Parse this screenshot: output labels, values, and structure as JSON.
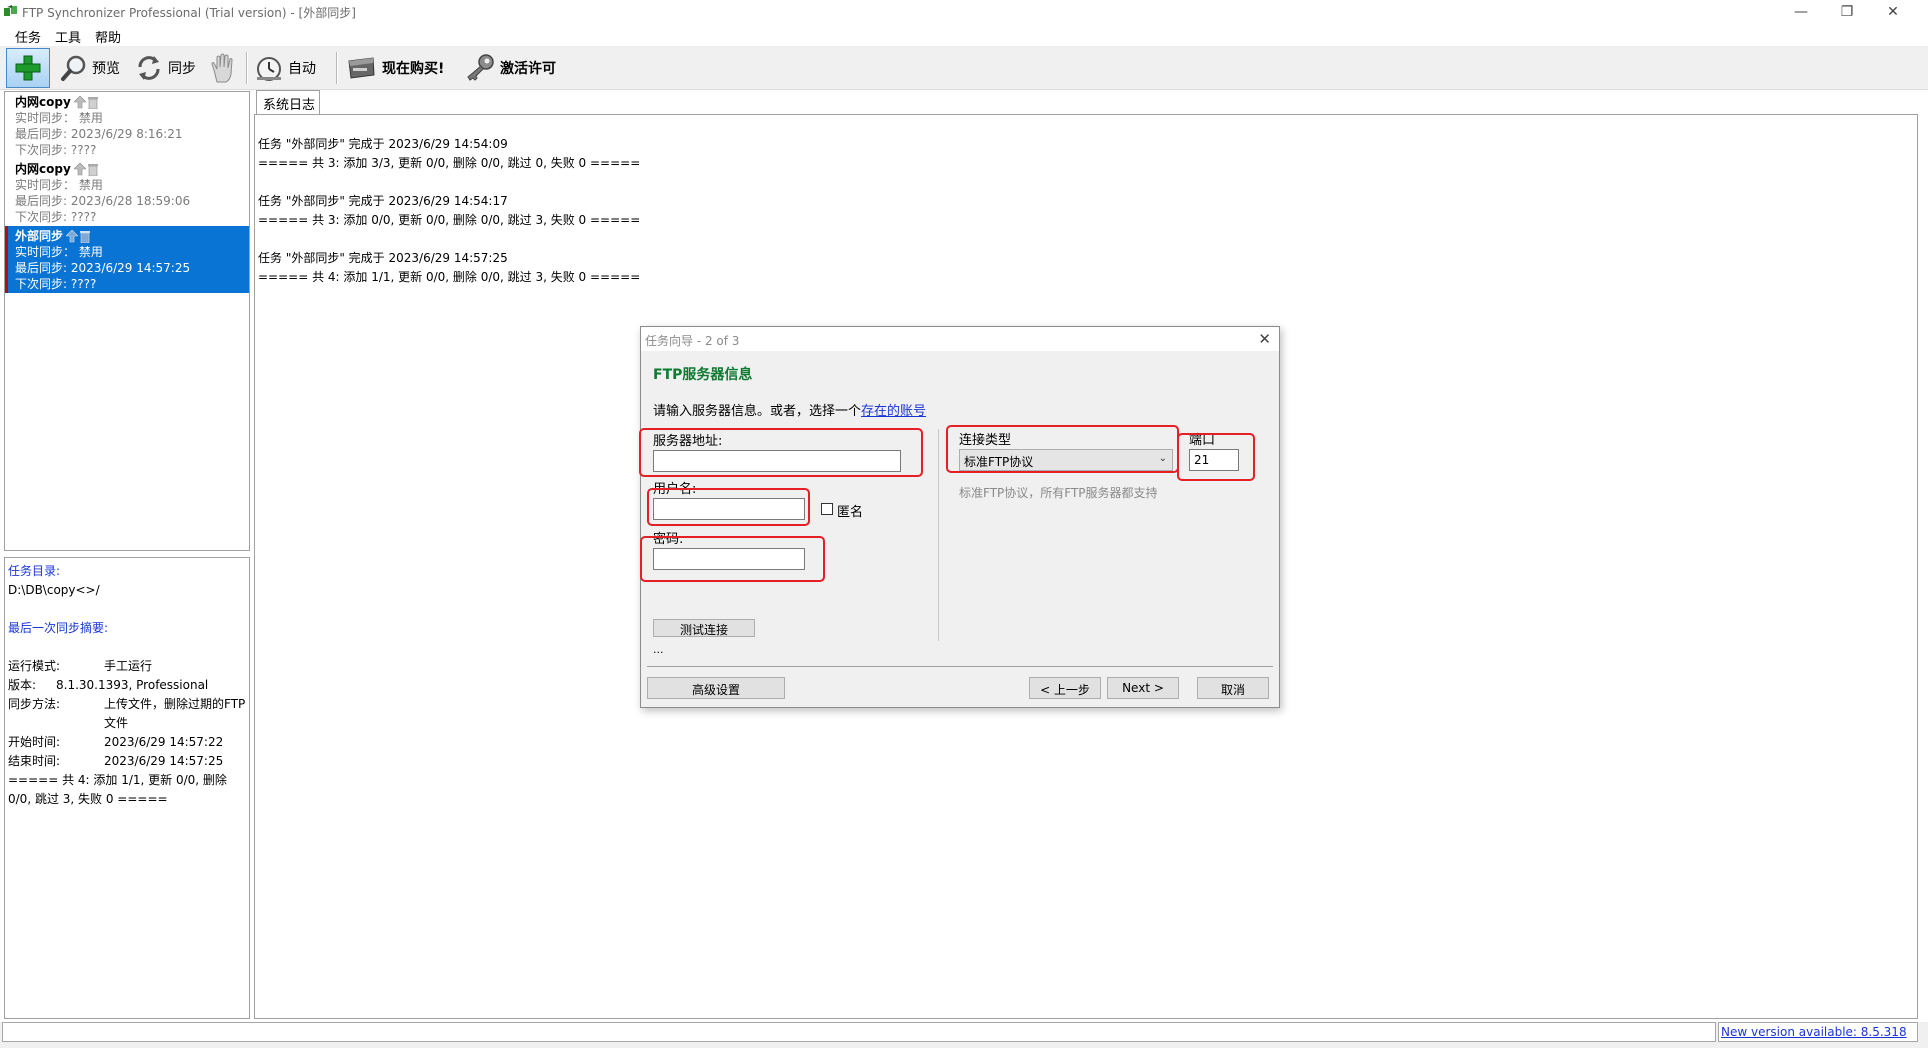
{
  "window": {
    "title": "FTP Synchronizer Professional (Trial version) - [外部同步]",
    "minimize_glyph": "—",
    "restore_glyph": "❐",
    "close_glyph": "✕"
  },
  "menu": [
    "任务",
    "工具",
    "帮助"
  ],
  "toolbar": {
    "preview_label": "预览",
    "sync_label": "同步",
    "auto_label": "自动",
    "buy_label": "现在购买!",
    "activate_label": "激活许可"
  },
  "tasks": [
    {
      "name": "内网copy",
      "realtime": "实时同步： 禁用",
      "last": "最后同步: 2023/6/29 8:16:21",
      "next": "下次同步: ????"
    },
    {
      "name": "内网copy",
      "realtime": "实时同步： 禁用",
      "last": "最后同步: 2023/6/28 18:59:06",
      "next": "下次同步: ????"
    },
    {
      "name": "外部同步",
      "realtime": "实时同步： 禁用",
      "last": "最后同步: 2023/6/29 14:57:25",
      "next": "下次同步: ????"
    }
  ],
  "info": {
    "dir_heading": "任务目录:",
    "dir_value": "D:\\DB\\copy<>/",
    "summary_heading": "最后一次同步摘要:",
    "rows": [
      {
        "k": "运行模式:",
        "v": "手工运行"
      },
      {
        "k": "版本:",
        "v": "8.1.30.1393, Professional"
      },
      {
        "k": "同步方法:",
        "v": "上传文件，删除过期的FTP文件"
      },
      {
        "k": "开始时间:",
        "v": "2023/6/29 14:57:22"
      },
      {
        "k": "结束时间:",
        "v": "2023/6/29 14:57:25"
      }
    ],
    "result": "===== 共 4: 添加 1/1, 更新 0/0, 删除 0/0, 跳过 3, 失败 0 ====="
  },
  "log_tab": "系统日志",
  "log": [
    {
      "line1": "任务 \"外部同步\" 完成于 2023/6/29 14:54:09",
      "line2": "===== 共 3: 添加 3/3, 更新 0/0, 删除 0/0, 跳过 0, 失败 0 ====="
    },
    {
      "line1": "任务 \"外部同步\" 完成于 2023/6/29 14:54:17",
      "line2": "===== 共 3: 添加 0/0, 更新 0/0, 删除 0/0, 跳过 3, 失败 0 ====="
    },
    {
      "line1": "任务 \"外部同步\" 完成于 2023/6/29 14:57:25",
      "line2": "===== 共 4: 添加 1/1, 更新 0/0, 删除 0/0, 跳过 3, 失败 0 ====="
    }
  ],
  "status": {
    "new_version": "New version available: 8.5.318"
  },
  "dialog": {
    "title": "任务向导 - 2 of 3",
    "close_glyph": "✕",
    "header": "FTP服务器信息",
    "intro_text": "请输入服务器信息。或者，选择一个",
    "intro_link": "存在的账号",
    "server_label": "服务器地址:",
    "server_value": "",
    "user_label": "用户名:",
    "user_value": "",
    "anonymous_label": "匿名",
    "password_label": "密码:",
    "password_value": "",
    "conn_type_label": "连接类型",
    "conn_type_value": "标准FTP协议",
    "conn_chevron": "⌄",
    "port_label": "端口",
    "port_value": "21",
    "conn_hint": "标准FTP协议，所有FTP服务器都支持",
    "test_button": "测试连接",
    "ellipsis": "...",
    "advanced_button": "高级设置",
    "back_button": "< 上一步",
    "next_button": "Next >",
    "cancel_button": "取消"
  },
  "colors": {
    "selection": "#0a74d4",
    "highlight_box": "#e61e25",
    "link": "#1a35d6",
    "dialog_header": "#0d7a2f"
  }
}
